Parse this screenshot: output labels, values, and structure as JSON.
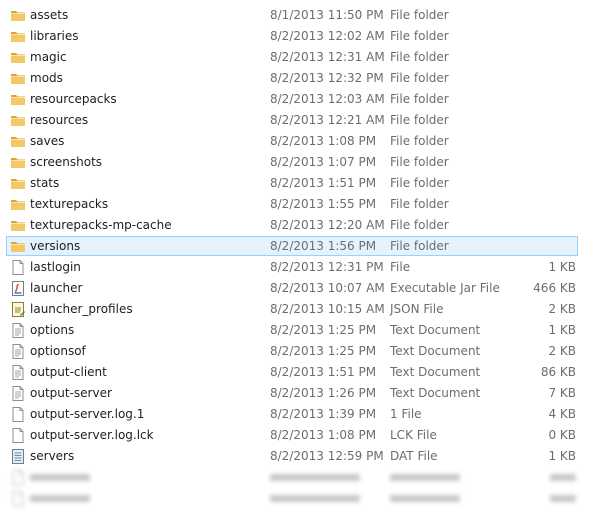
{
  "files": [
    {
      "name": "assets",
      "date": "8/1/2013 11:50 PM",
      "type": "File folder",
      "size": "",
      "icon": "folder-icon"
    },
    {
      "name": "libraries",
      "date": "8/2/2013 12:02 AM",
      "type": "File folder",
      "size": "",
      "icon": "folder-icon"
    },
    {
      "name": "magic",
      "date": "8/2/2013 12:31 AM",
      "type": "File folder",
      "size": "",
      "icon": "folder-icon"
    },
    {
      "name": "mods",
      "date": "8/2/2013 12:32 PM",
      "type": "File folder",
      "size": "",
      "icon": "folder-icon"
    },
    {
      "name": "resourcepacks",
      "date": "8/2/2013 12:03 AM",
      "type": "File folder",
      "size": "",
      "icon": "folder-icon"
    },
    {
      "name": "resources",
      "date": "8/2/2013 12:21 AM",
      "type": "File folder",
      "size": "",
      "icon": "folder-icon"
    },
    {
      "name": "saves",
      "date": "8/2/2013 1:08 PM",
      "type": "File folder",
      "size": "",
      "icon": "folder-icon"
    },
    {
      "name": "screenshots",
      "date": "8/2/2013 1:07 PM",
      "type": "File folder",
      "size": "",
      "icon": "folder-icon"
    },
    {
      "name": "stats",
      "date": "8/2/2013 1:51 PM",
      "type": "File folder",
      "size": "",
      "icon": "folder-icon"
    },
    {
      "name": "texturepacks",
      "date": "8/2/2013 1:55 PM",
      "type": "File folder",
      "size": "",
      "icon": "folder-icon"
    },
    {
      "name": "texturepacks-mp-cache",
      "date": "8/2/2013 12:20 AM",
      "type": "File folder",
      "size": "",
      "icon": "folder-icon"
    },
    {
      "name": "versions",
      "date": "8/2/2013 1:56 PM",
      "type": "File folder",
      "size": "",
      "icon": "folder-icon",
      "selected": true
    },
    {
      "name": "lastlogin",
      "date": "8/2/2013 12:31 PM",
      "type": "File",
      "size": "1 KB",
      "icon": "file-icon"
    },
    {
      "name": "launcher",
      "date": "8/2/2013 10:07 AM",
      "type": "Executable Jar File",
      "size": "466 KB",
      "icon": "java-jar-icon"
    },
    {
      "name": "launcher_profiles",
      "date": "8/2/2013 10:15 AM",
      "type": "JSON File",
      "size": "2 KB",
      "icon": "json-file-icon"
    },
    {
      "name": "options",
      "date": "8/2/2013 1:25 PM",
      "type": "Text Document",
      "size": "1 KB",
      "icon": "text-document-icon"
    },
    {
      "name": "optionsof",
      "date": "8/2/2013 1:25 PM",
      "type": "Text Document",
      "size": "2 KB",
      "icon": "text-document-icon"
    },
    {
      "name": "output-client",
      "date": "8/2/2013 1:51 PM",
      "type": "Text Document",
      "size": "86 KB",
      "icon": "text-document-icon"
    },
    {
      "name": "output-server",
      "date": "8/2/2013 1:26 PM",
      "type": "Text Document",
      "size": "7 KB",
      "icon": "text-document-icon"
    },
    {
      "name": "output-server.log.1",
      "date": "8/2/2013 1:39 PM",
      "type": "1 File",
      "size": "4 KB",
      "icon": "file-icon"
    },
    {
      "name": "output-server.log.lck",
      "date": "8/2/2013 1:08 PM",
      "type": "LCK File",
      "size": "0 KB",
      "icon": "file-icon"
    },
    {
      "name": "servers",
      "date": "8/2/2013 12:59 PM",
      "type": "DAT File",
      "size": "1 KB",
      "icon": "dat-file-icon"
    }
  ],
  "colors": {
    "folder": "#e8b54a",
    "selection_fill": "#e5f3ff",
    "selection_border": "#99d1ff",
    "secondary_text": "#6d6d6d"
  }
}
